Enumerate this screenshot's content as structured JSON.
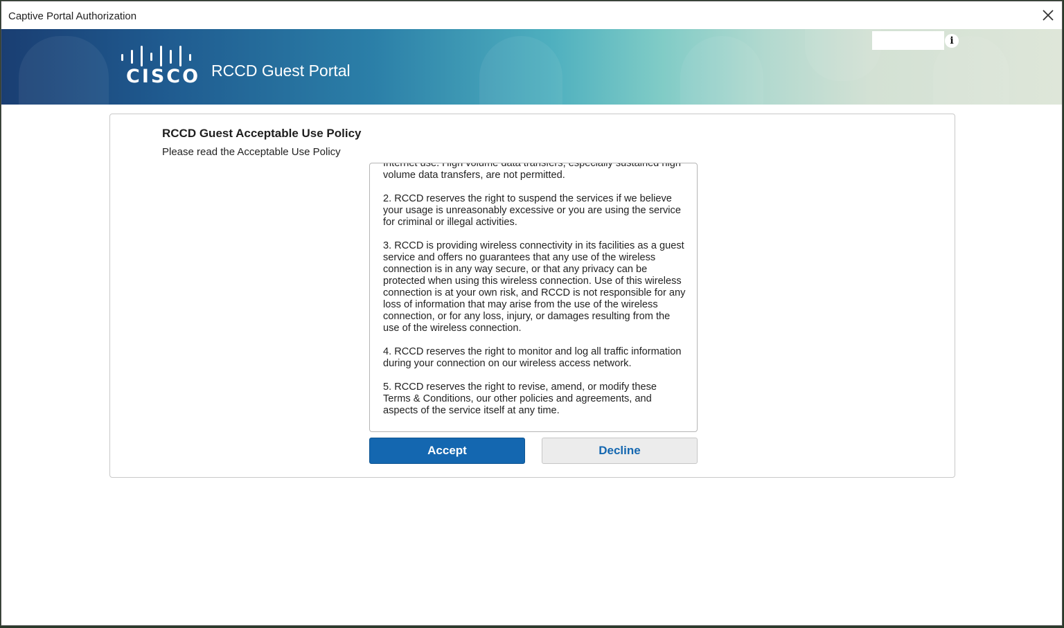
{
  "window": {
    "title": "Captive Portal Authorization"
  },
  "header": {
    "logo_text": "CISCO",
    "portal_title": "RCCD Guest Portal",
    "language_value": ""
  },
  "policy": {
    "heading": "RCCD Guest Acceptable Use Policy",
    "subheading": "Please read the Acceptable Use Policy",
    "paragraphs": [
      "Internet use. High volume data transfers, especially sustained high volume data transfers, are not permitted.",
      "2. RCCD reserves the right to suspend the services if we believe your usage is unreasonably excessive or you are using the service for criminal or illegal activities.",
      "3. RCCD is providing wireless connectivity in its facilities as a guest service and offers no guarantees that any use of the wireless connection is in any way secure, or that any privacy can be protected when using this wireless connection. Use of this wireless connection is at your own risk, and RCCD is not responsible for any loss of information that may arise from the use of the wireless connection, or for any loss, injury, or damages resulting from the use of the wireless connection.",
      "4. RCCD reserves the right to monitor and log all traffic information during your connection on our wireless access network.",
      "5. RCCD reserves the right to revise, amend, or modify these Terms & Conditions, our other policies and agreements, and aspects of the service itself at any time."
    ]
  },
  "actions": {
    "accept_label": "Accept",
    "decline_label": "Decline"
  }
}
